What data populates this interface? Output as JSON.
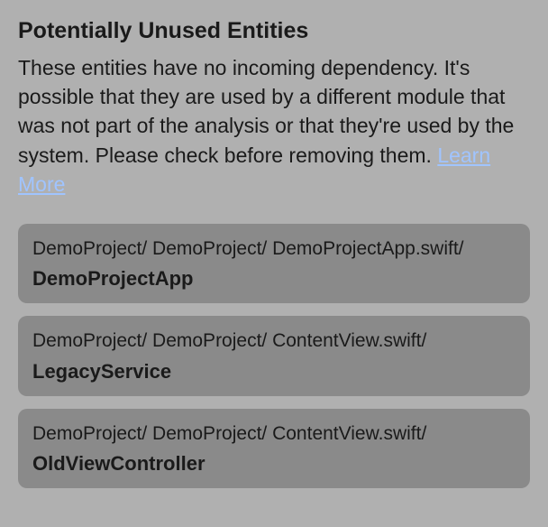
{
  "header": {
    "title": "Potentially Unused Entities",
    "description_before": "These entities have no incoming dependency. It's possible that they are used by a different module that was not part of the analysis or that they're used by the system. Please check before removing them. ",
    "learn_more_label": "Learn More"
  },
  "entities": [
    {
      "path": "DemoProject/ DemoProject/ DemoProjectApp.swift/",
      "name": "DemoProjectApp"
    },
    {
      "path": "DemoProject/ DemoProject/ ContentView.swift/",
      "name": "LegacyService"
    },
    {
      "path": "DemoProject/ DemoProject/ ContentView.swift/",
      "name": "OldViewController"
    }
  ]
}
